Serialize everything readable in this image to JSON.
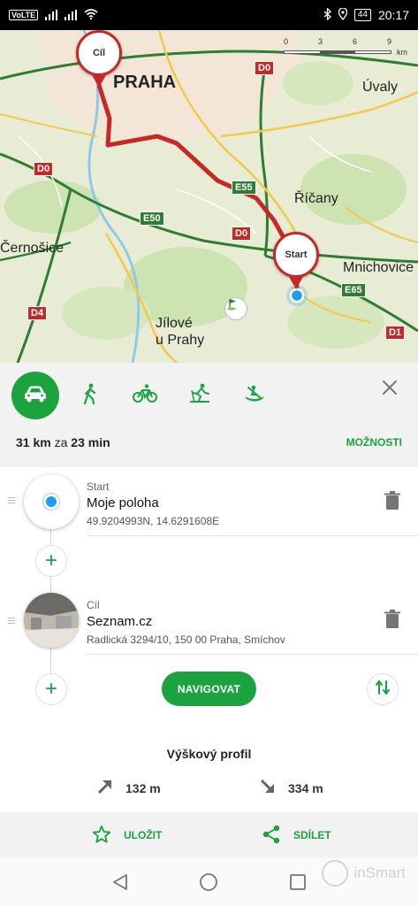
{
  "status_bar": {
    "network_badge": "VoLTE",
    "battery": "44",
    "time": "20:17"
  },
  "map": {
    "scale": {
      "ticks": [
        "0",
        "3",
        "6",
        "9"
      ],
      "unit": "km"
    },
    "places": {
      "praha": "PRAHA",
      "uvaly": "Úvaly",
      "ricany": "Říčany",
      "cernosice": "Černošice",
      "mnichovice": "Mnichovice",
      "jilove": "Jílové\nu Prahy"
    },
    "roads": {
      "d0_top": "D0",
      "d0_left": "D0",
      "d0_mid": "D0",
      "e55": "E55",
      "e50": "E50",
      "e65": "E65",
      "d4": "D4",
      "d1": "D1"
    },
    "pins": {
      "destination": "Cíl",
      "start": "Start"
    }
  },
  "route": {
    "modes": [
      "car-icon",
      "walk-icon",
      "bike-icon",
      "ski-icon",
      "boat-icon"
    ],
    "active_mode": "car-icon",
    "distance": "31 km",
    "joiner": "za",
    "duration": "23 min",
    "options_label": "MOŽNOSTI"
  },
  "waypoints": [
    {
      "kind": "Start",
      "name": "Moje poloha",
      "detail": "49.9204993N, 14.6291608E"
    },
    {
      "kind": "Cíl",
      "name": "Seznam.cz",
      "detail": "Radlická 3294/10, 150 00  Praha, Smíchov"
    }
  ],
  "actions": {
    "navigate_label": "NAVIGOVAT",
    "save_label": "ULOŽIT",
    "share_label": "SDÍLET"
  },
  "elevation": {
    "title": "Výškový profil",
    "ascent": "132 m",
    "descent": "334 m"
  },
  "watermark": "inSmart",
  "colors": {
    "accent": "#1aa33f",
    "route": "#c62828",
    "location": "#1e9cf0"
  }
}
